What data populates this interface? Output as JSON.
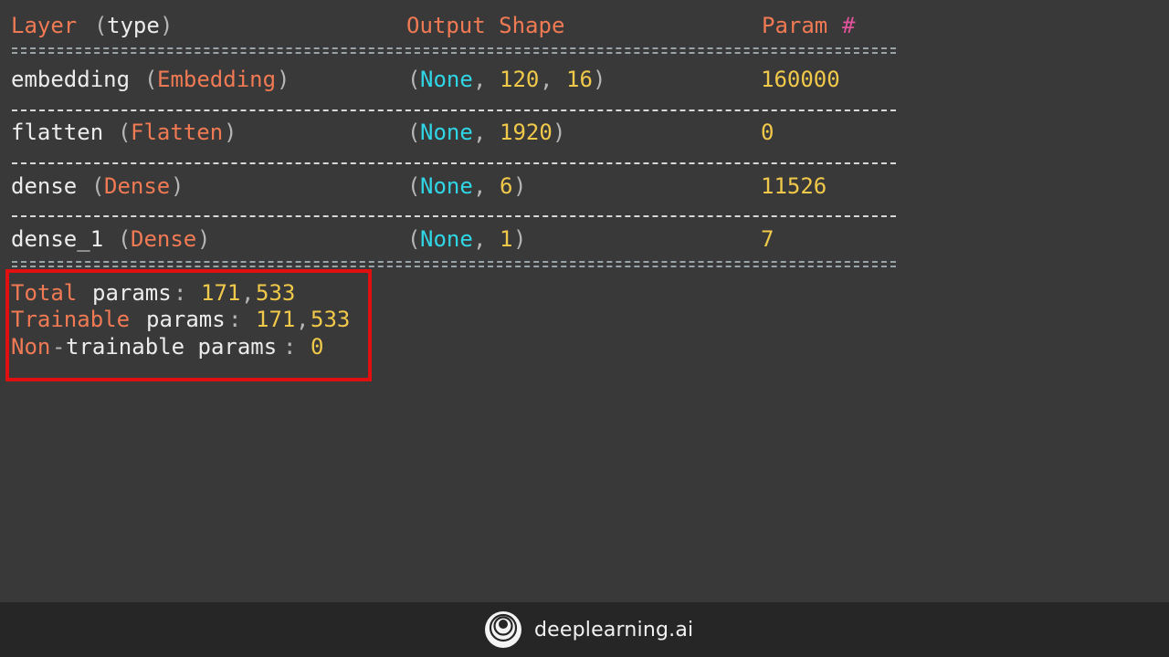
{
  "header": {
    "layer_label": "Layer",
    "layer_type_label": "type",
    "output_shape_label": "Output Shape",
    "param_label": "Param",
    "param_hash": "#"
  },
  "layers": [
    {
      "name": "embedding",
      "type": "Embedding",
      "shape_none": "None",
      "shape_dims": [
        "120",
        "16"
      ],
      "params": "160000"
    },
    {
      "name": "flatten",
      "type": "Flatten",
      "shape_none": "None",
      "shape_dims": [
        "1920"
      ],
      "params": "0"
    },
    {
      "name": "dense",
      "type": "Dense",
      "shape_none": "None",
      "shape_dims": [
        "6"
      ],
      "params": "11526"
    },
    {
      "name": "dense_1",
      "type": "Dense",
      "shape_none": "None",
      "shape_dims": [
        "1"
      ],
      "params": "7"
    }
  ],
  "summary": {
    "total": {
      "label_a": "Total",
      "label_b": "params",
      "value_a": "171",
      "value_b": "533"
    },
    "trainable": {
      "label_a": "Trainable",
      "label_b": "params",
      "value_a": "171",
      "value_b": "533"
    },
    "non_trainable": {
      "label_a": "Non",
      "label_b": "trainable params",
      "value": "0"
    }
  },
  "footer": {
    "brand_text": "deeplearning.ai",
    "logo_icon": "deeplearning-logo-icon"
  },
  "colors": {
    "background": "#393939",
    "footer_background": "#262626",
    "highlight_box": "#e01010",
    "keyword": "#f07a54",
    "number": "#f1c94a",
    "none": "#30d6e6",
    "hash": "#e0539a"
  }
}
